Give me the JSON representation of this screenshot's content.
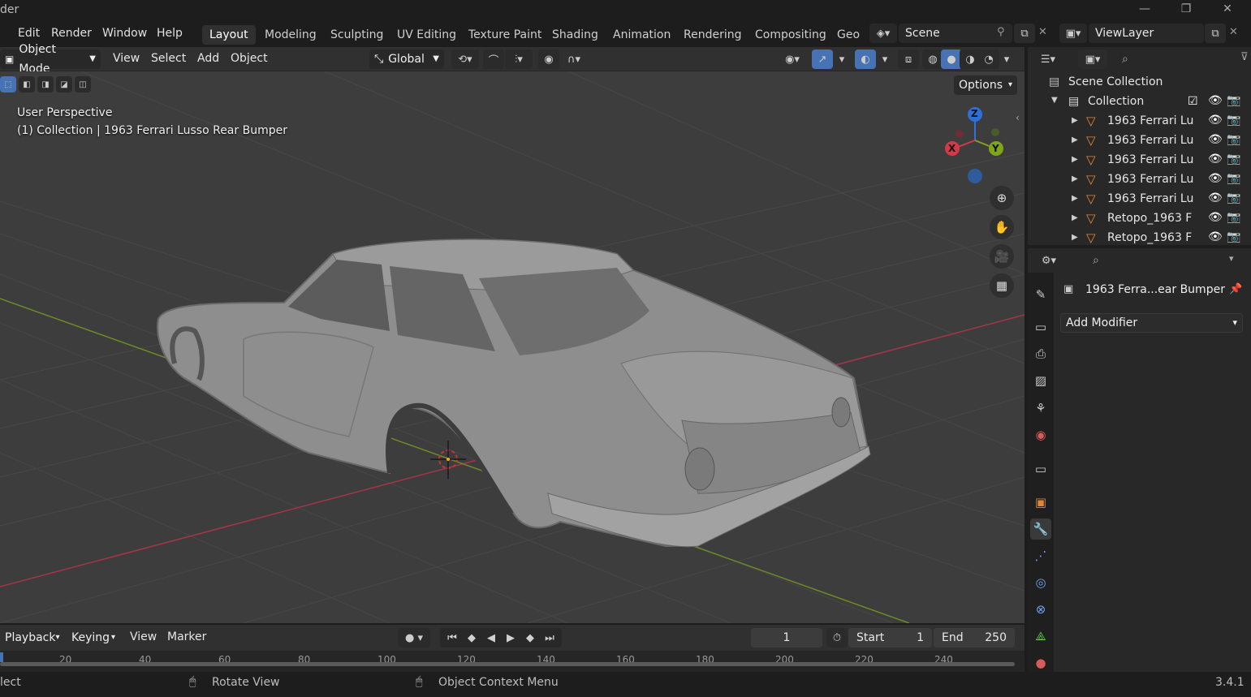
{
  "window": {
    "title_fragment": "der",
    "min_icon": "minimize-icon",
    "max_icon": "restore-icon",
    "close_icon": "close-icon"
  },
  "menu": {
    "items": [
      "Edit",
      "Render",
      "Window",
      "Help"
    ]
  },
  "workspaces": [
    "Layout",
    "Modeling",
    "Sculpting",
    "UV Editing",
    "Texture Paint",
    "Shading",
    "Animation",
    "Rendering",
    "Compositing",
    "Geo"
  ],
  "active_workspace": "Layout",
  "scene": {
    "name": "Scene"
  },
  "view_layer": {
    "name": "ViewLayer"
  },
  "viewport_header": {
    "mode": "Object Mode",
    "menus": [
      "View",
      "Select",
      "Add",
      "Object"
    ],
    "transform_orientation": "Global",
    "options_label": "Options"
  },
  "viewport": {
    "perspective": "User Perspective",
    "context": "(1) Collection | 1963 Ferrari Lusso Rear Bumper",
    "gizmo": {
      "x": "X",
      "y": "Y",
      "z": "Z"
    },
    "colors": {
      "bg": "#3d3d3d",
      "grid": "#4a4a4a",
      "x_axis": "#a6354a",
      "y_axis": "#6c8a26",
      "body": "#8e8e8e"
    }
  },
  "outliner": {
    "scene_collection": "Scene Collection",
    "collection": "Collection",
    "items": [
      "1963 Ferrari Lu",
      "1963 Ferrari Lu",
      "1963 Ferrari Lu",
      "1963 Ferrari Lu",
      "1963 Ferrari Lu",
      "Retopo_1963 F",
      "Retopo_1963 F"
    ]
  },
  "properties": {
    "object_name": "1963 Ferra...ear Bumper",
    "add_modifier": "Add Modifier",
    "tabs": [
      "tool-icon",
      "render-icon",
      "output-icon",
      "view-layer-icon",
      "scene-icon",
      "world-icon",
      "collection-icon",
      "object-icon",
      "modifier-icon",
      "particles-icon",
      "physics-icon",
      "constraints-icon",
      "data-icon",
      "material-icon"
    ],
    "active_tab": "modifier-icon"
  },
  "timeline": {
    "menus": [
      "Playback",
      "Keying",
      "View",
      "Marker"
    ],
    "current_frame": "1",
    "start_label": "Start",
    "start": "1",
    "end_label": "End",
    "end": "250",
    "ticks": [
      "20",
      "40",
      "60",
      "80",
      "100",
      "120",
      "140",
      "160",
      "180",
      "200",
      "220",
      "240"
    ]
  },
  "status": {
    "left": "lect",
    "rotate": "Rotate View",
    "context_menu": "Object Context Menu",
    "version": "3.4.1"
  }
}
